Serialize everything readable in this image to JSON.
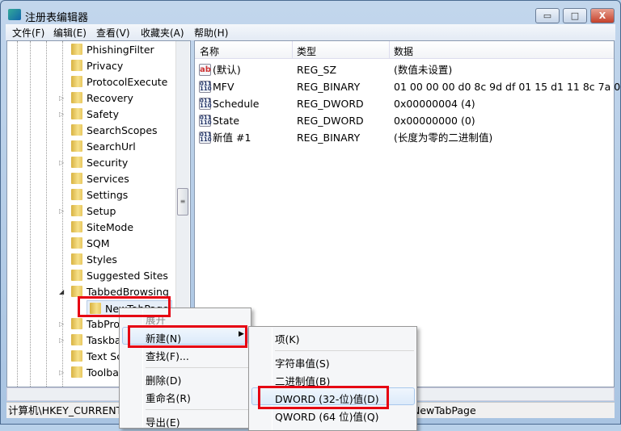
{
  "window": {
    "title": "注册表编辑器",
    "minimize": "▭",
    "maximize": "□",
    "close": "X"
  },
  "menubar": [
    "文件(F)",
    "编辑(E)",
    "查看(V)",
    "收藏夹(A)",
    "帮助(H)"
  ],
  "tree": {
    "items": [
      "PhishingFilter",
      "Privacy",
      "ProtocolExecute",
      "Recovery",
      "Safety",
      "SearchScopes",
      "SearchUrl",
      "Security",
      "Services",
      "Settings",
      "Setup",
      "SiteMode",
      "SQM",
      "Styles",
      "Suggested Sites",
      "TabbedBrowsing",
      "NewTabPage",
      "TabPro",
      "Taskba",
      "Text Sc",
      "Toolba"
    ],
    "selected": "NewTabPage"
  },
  "list": {
    "headers": [
      "名称",
      "类型",
      "数据"
    ],
    "rows": [
      {
        "icon": "string-value-icon",
        "name": "(默认)",
        "type": "REG_SZ",
        "data": "(数值未设置)"
      },
      {
        "icon": "binary-value-icon",
        "name": "MFV",
        "type": "REG_BINARY",
        "data": "01 00 00 00 d0 8c 9d df 01 15 d1 11 8c 7a 00.."
      },
      {
        "icon": "binary-value-icon",
        "name": "Schedule",
        "type": "REG_DWORD",
        "data": "0x00000004 (4)"
      },
      {
        "icon": "binary-value-icon",
        "name": "State",
        "type": "REG_DWORD",
        "data": "0x00000000 (0)"
      },
      {
        "icon": "binary-value-icon",
        "name": "新值 #1",
        "type": "REG_BINARY",
        "data": "(长度为零的二进制值)"
      }
    ]
  },
  "status": {
    "left": "计算机\\HKEY_CURRENT_",
    "right": "NewTabPage"
  },
  "context_menu": {
    "items": [
      "展开",
      "新建(N)",
      "查找(F)...",
      "删除(D)",
      "重命名(R)",
      "导出(E)"
    ],
    "highlighted": "新建(N)"
  },
  "submenu": {
    "items": [
      "项(K)",
      "字符串值(S)",
      "二进制值(B)",
      "DWORD (32-位)值(D)",
      "QWORD (64 位)值(Q)"
    ],
    "highlighted": "DWORD (32-位)值(D)"
  },
  "colors": {
    "highlight_box": "#e60012"
  }
}
